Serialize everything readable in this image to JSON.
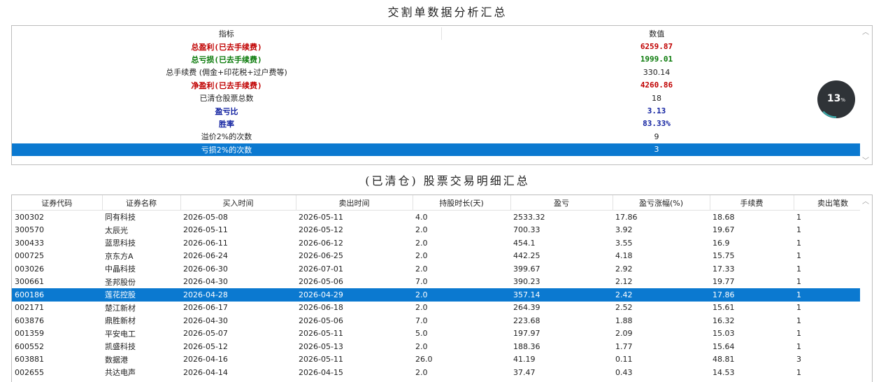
{
  "summary_title": "交割单数据分析汇总",
  "detail_title": "(已清仓) 股票交易明细汇总",
  "summary": {
    "headers": [
      "指标",
      "数值"
    ],
    "rows": [
      {
        "label": "总盈利(已去手续费)",
        "value": "6259.87",
        "style": "red"
      },
      {
        "label": "总亏损(已去手续费)",
        "value": "1999.01",
        "style": "green"
      },
      {
        "label": "总手续费 (佣金+印花税+过户费等)",
        "value": "330.14",
        "style": "normal"
      },
      {
        "label": "净盈利(已去手续费)",
        "value": "4260.86",
        "style": "red"
      },
      {
        "label": "已清仓股票总数",
        "value": "18",
        "style": "normal"
      },
      {
        "label": "盈亏比",
        "value": "3.13",
        "style": "blue"
      },
      {
        "label": "胜率",
        "value": "83.33%",
        "style": "blue"
      },
      {
        "label": "溢价2%的次数",
        "value": "9",
        "style": "normal"
      },
      {
        "label": "亏损2%的次数",
        "value": "3",
        "style": "selected"
      }
    ]
  },
  "progress": {
    "value": "13",
    "unit": "%",
    "fraction": 0.13,
    "ring_color": "#3aa6a6",
    "bg_color": "#2f3337"
  },
  "detail": {
    "headers": [
      "证券代码",
      "证券名称",
      "买入时间",
      "卖出时间",
      "持股时长(天)",
      "盈亏",
      "盈亏涨幅(%)",
      "手续费",
      "卖出笔数"
    ],
    "rows": [
      [
        "300302",
        "同有科技",
        "2026-05-08",
        "2026-05-11",
        "4.0",
        "2533.32",
        "17.86",
        "18.68",
        "1"
      ],
      [
        "300570",
        "太辰光",
        "2026-05-11",
        "2026-05-12",
        "2.0",
        "700.33",
        "3.92",
        "19.67",
        "1"
      ],
      [
        "300433",
        "蓝思科技",
        "2026-06-11",
        "2026-06-12",
        "2.0",
        "454.1",
        "3.55",
        "16.9",
        "1"
      ],
      [
        "000725",
        "京东方A",
        "2026-06-24",
        "2026-06-25",
        "2.0",
        "442.25",
        "4.18",
        "15.75",
        "1"
      ],
      [
        "003026",
        "中晶科技",
        "2026-06-30",
        "2026-07-01",
        "2.0",
        "399.67",
        "2.92",
        "17.33",
        "1"
      ],
      [
        "300661",
        "圣邦股份",
        "2026-04-30",
        "2026-05-06",
        "7.0",
        "390.23",
        "2.12",
        "19.77",
        "1"
      ],
      [
        "600186",
        "莲花控股",
        "2026-04-28",
        "2026-04-29",
        "2.0",
        "357.14",
        "2.42",
        "17.86",
        "1"
      ],
      [
        "002171",
        "楚江新材",
        "2026-06-17",
        "2026-06-18",
        "2.0",
        "264.39",
        "2.52",
        "15.61",
        "1"
      ],
      [
        "603876",
        "鼎胜新材",
        "2026-04-30",
        "2026-05-06",
        "7.0",
        "223.68",
        "1.88",
        "16.32",
        "1"
      ],
      [
        "001359",
        "平安电工",
        "2026-05-07",
        "2026-05-11",
        "5.0",
        "197.97",
        "2.09",
        "15.03",
        "1"
      ],
      [
        "600552",
        "凯盛科技",
        "2026-05-12",
        "2026-05-13",
        "2.0",
        "188.36",
        "1.77",
        "15.64",
        "1"
      ],
      [
        "603881",
        "数据港",
        "2026-04-16",
        "2026-05-11",
        "26.0",
        "41.19",
        "0.11",
        "48.81",
        "3"
      ],
      [
        "002655",
        "共达电声",
        "2026-04-14",
        "2026-04-15",
        "2.0",
        "37.47",
        "0.43",
        "14.53",
        "1"
      ]
    ],
    "selected_row": 6
  },
  "colors": {
    "selection": "#0b79d0",
    "profit": "#c00000",
    "loss": "#0a7a0a",
    "ratio": "#1020a0"
  }
}
